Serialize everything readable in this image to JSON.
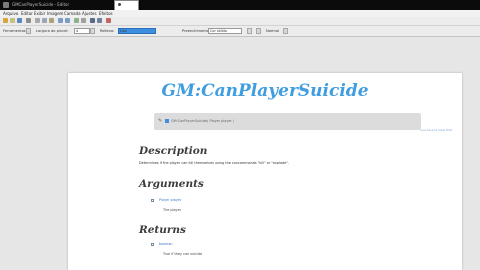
{
  "window": {
    "title": "GMCanPlayerSuicide - Editor"
  },
  "menubar": {
    "items": [
      "Arquivo",
      "Editar",
      "Exibir",
      "Imagem",
      "Camada",
      "Ajustes",
      "Efeitos"
    ]
  },
  "toolbar2": {
    "tool_label": "Ferramentas:",
    "brush_width_label": "Largura do pincel:",
    "brush_width_value": "4",
    "fill_label": "Relleno:",
    "fill_value": "Liso",
    "antialias_label": "Preenchimento:",
    "antialias_value": "Cor sólida",
    "blend_label": "Normal"
  },
  "page": {
    "title": "GM:CanPlayerSuicide",
    "codebar_text": "GM:CanPlayerSuicide( Player  player )",
    "links": "Lua   Source  View  Edit",
    "description_heading": "Description",
    "description_text": "Determines if the player can kill themselves using the concommands \"kill\" or \"explode\".",
    "arguments_heading": "Arguments",
    "arguments": [
      {
        "name": "Player player",
        "desc": "The player"
      }
    ],
    "returns_heading": "Returns",
    "returns": [
      {
        "name": "boolean",
        "desc": "True if they can suicide"
      }
    ]
  },
  "colors": {
    "title_blue": "#3f9de0",
    "link_blue": "#3e78c2",
    "selected_field": "#3d8fe0"
  }
}
